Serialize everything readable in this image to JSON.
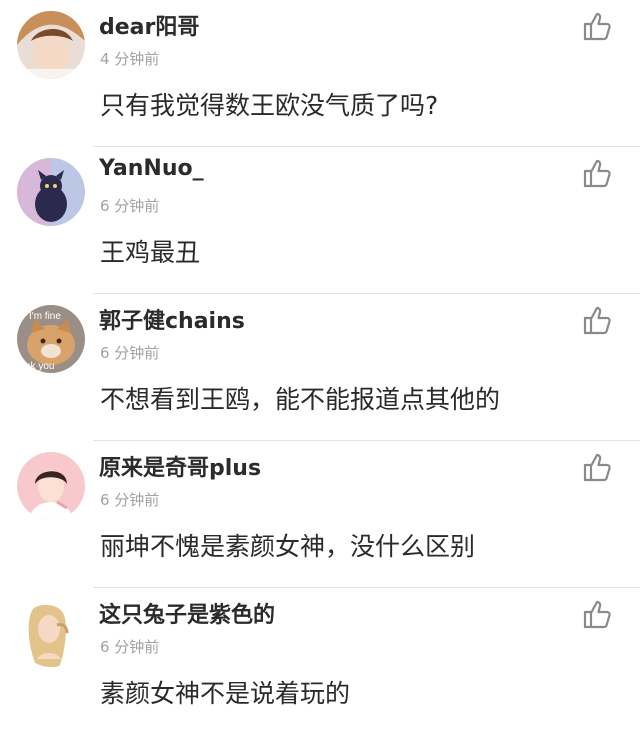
{
  "comments": [
    {
      "username": "dear阳哥",
      "time": "4 分钟前",
      "text": "只有我觉得数王欧没气质了吗?"
    },
    {
      "username": "YanNuo_",
      "time": "6 分钟前",
      "text": "王鸡最丑"
    },
    {
      "username": "郭子健chains",
      "time": "6 分钟前",
      "text": "不想看到王鸥，能不能报道点其他的",
      "avatar_text_1": "I'm fine",
      "avatar_text_2": "uck you"
    },
    {
      "username": "原来是奇哥plus",
      "time": "6 分钟前",
      "text": "丽坤不愧是素颜女神，没什么区别"
    },
    {
      "username": "这只兔子是紫色的",
      "time": "6 分钟前",
      "text": "素颜女神不是说着玩的"
    }
  ],
  "icons": {
    "like": "thumbs-up-icon"
  },
  "colors": {
    "username": "#2b2b2b",
    "time": "#a2a2a2",
    "text": "#2a2a2a",
    "divider": "#e3e3e3"
  }
}
